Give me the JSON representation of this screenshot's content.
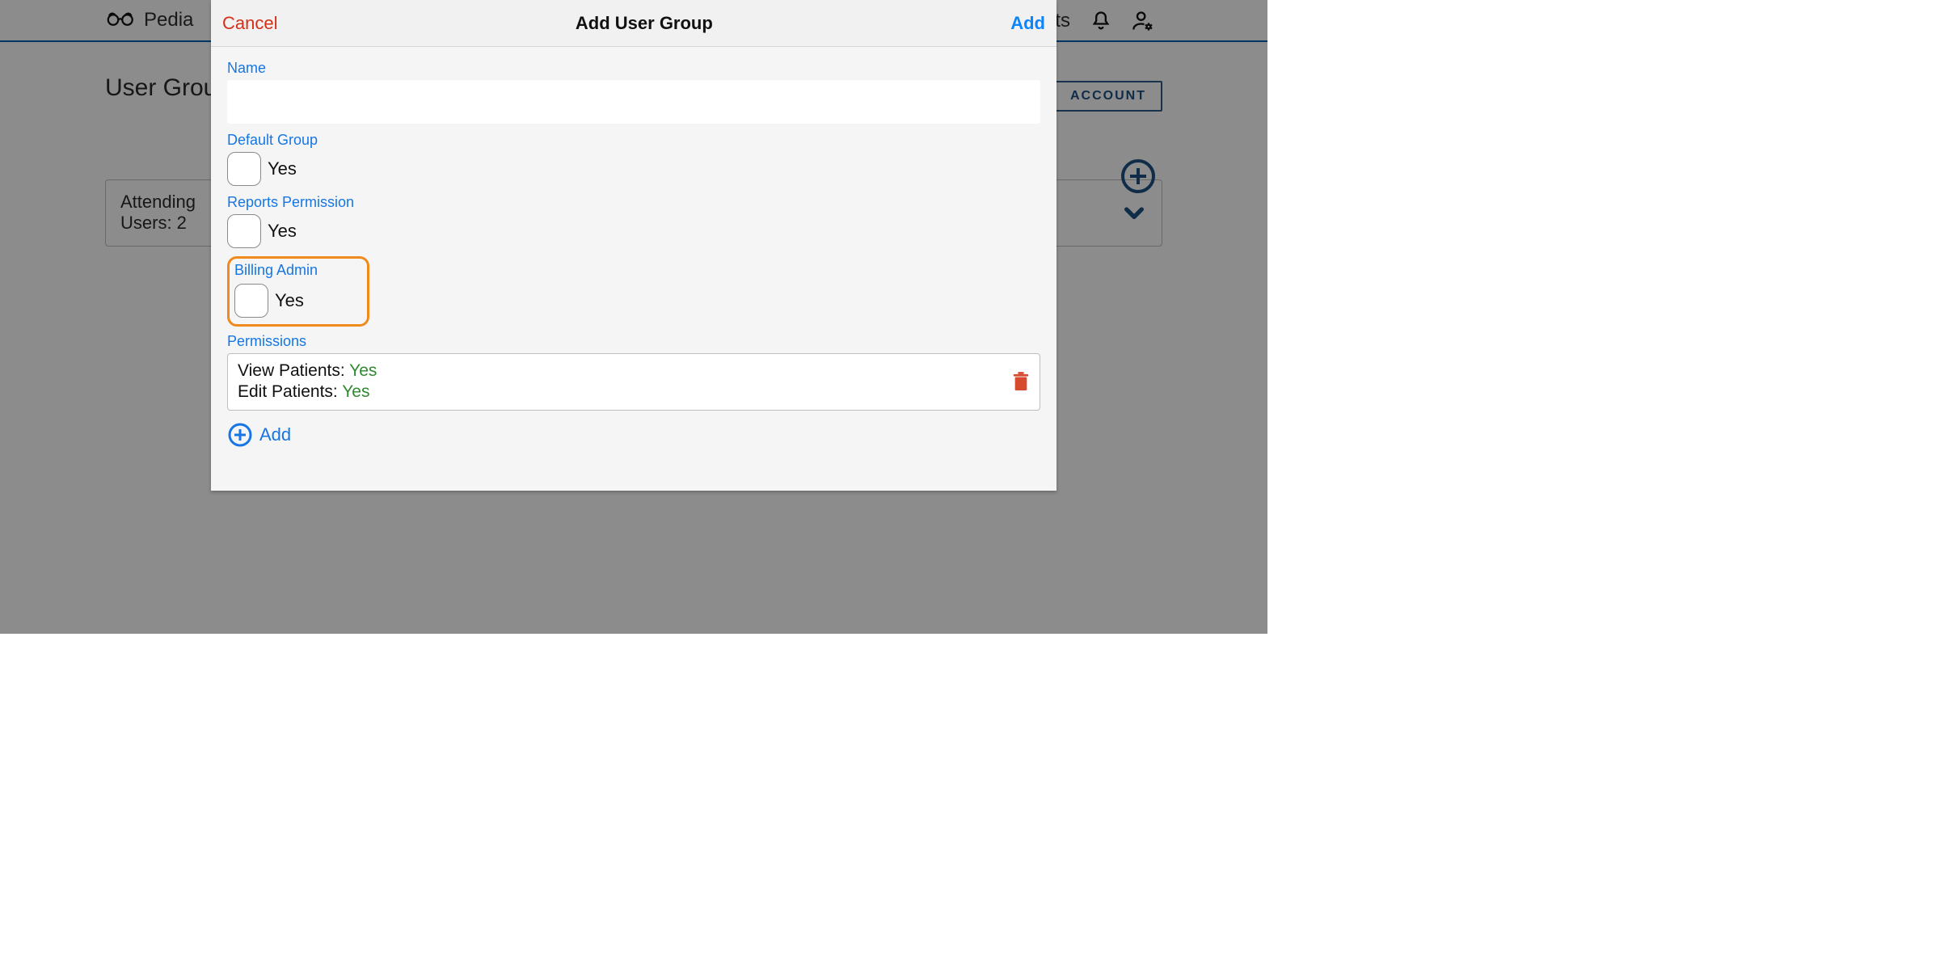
{
  "topbar": {
    "brand_text": "Pedia",
    "right_text_fragment": "ts"
  },
  "page": {
    "title": "User Grou",
    "account_button": "ACCOUNT"
  },
  "group_card": {
    "name": "Attending",
    "users_label": "Users: 2"
  },
  "modal": {
    "cancel": "Cancel",
    "title": "Add User Group",
    "add": "Add",
    "fields": {
      "name_label": "Name",
      "name_value": "",
      "default_group_label": "Default Group",
      "default_group_text": "Yes",
      "reports_label": "Reports Permission",
      "reports_text": "Yes",
      "billing_label": "Billing Admin",
      "billing_text": "Yes",
      "permissions_label": "Permissions"
    },
    "permissions": {
      "line1_key": "View Patients: ",
      "line1_val": "Yes",
      "line2_key": "Edit Patients: ",
      "line2_val": "Yes"
    },
    "add_row_label": "Add"
  }
}
